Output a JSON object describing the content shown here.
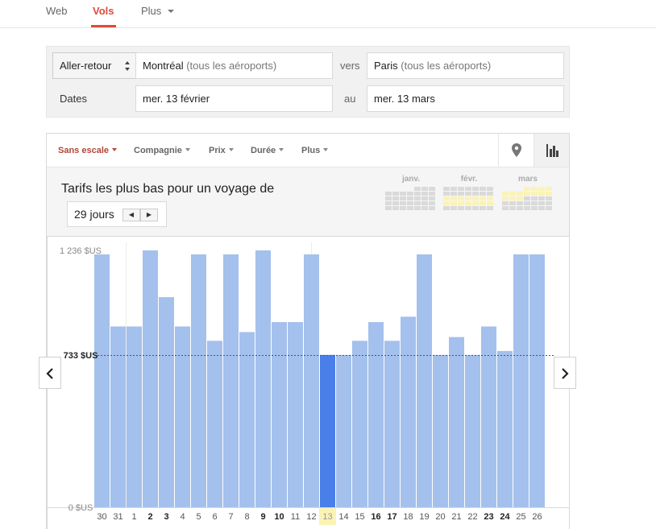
{
  "topnav": {
    "tabs": [
      {
        "label": "Web"
      },
      {
        "label": "Vols"
      },
      {
        "label": "Plus"
      }
    ]
  },
  "search": {
    "trip_type": "Aller-retour",
    "origin_city": "Montréal",
    "origin_hint": "(tous les aéroports)",
    "to_label": "vers",
    "dest_city": "Paris",
    "dest_hint": "(tous les aéroports)",
    "dates_label": "Dates",
    "depart_date": "mer. 13 février",
    "between_label": "au",
    "return_date": "mer. 13 mars"
  },
  "filters": {
    "stops": "Sans escale",
    "airline": "Compagnie",
    "price": "Prix",
    "duration": "Durée",
    "more": "Plus",
    "map_icon": "map-pin-icon",
    "chart_icon": "bar-chart-icon"
  },
  "summary": {
    "title": "Tarifs les plus bas pour un voyage de",
    "duration": "29 jours",
    "prev_symbol": "◀",
    "next_symbol": "▶"
  },
  "calendar_months": [
    {
      "label": "janv."
    },
    {
      "label": "févr."
    },
    {
      "label": "mars"
    }
  ],
  "colors": {
    "accent_red": "#dd4b39",
    "bar": "#a4c0ec",
    "bar_selected": "#4a7ee8",
    "selected_highlight": "#fbf3b5"
  },
  "chart_data": {
    "type": "bar",
    "title": "",
    "xlabel": "",
    "ylabel": "",
    "y_tick_labels": [
      "1 236 $US",
      "733 $US",
      "0 $US"
    ],
    "y_ticks": [
      1236,
      733,
      0
    ],
    "reference_line": {
      "value": 733,
      "label": "733 $US"
    },
    "ylim": [
      0,
      1236
    ],
    "categories": [
      "30",
      "31",
      "1",
      "2",
      "3",
      "4",
      "5",
      "6",
      "7",
      "8",
      "9",
      "10",
      "11",
      "12",
      "13",
      "14",
      "15",
      "16",
      "17",
      "18",
      "19",
      "20",
      "21",
      "22",
      "23",
      "24",
      "25",
      "26"
    ],
    "bold_categories": [
      "2",
      "3",
      "9",
      "10",
      "16",
      "17",
      "23",
      "24"
    ],
    "selected_category": "13",
    "values": [
      1217,
      870,
      870,
      1236,
      1011,
      870,
      1217,
      801,
      1217,
      843,
      1236,
      891,
      891,
      1217,
      733,
      733,
      801,
      891,
      801,
      917,
      1217,
      733,
      819,
      733,
      870,
      752,
      1217,
      1217
    ]
  }
}
